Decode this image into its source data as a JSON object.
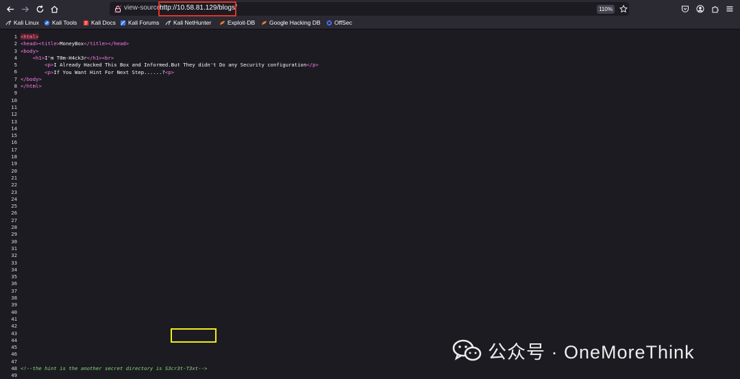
{
  "browser": {
    "url_prefix": "view-source:",
    "url": "http://10.58.81.129/blogs/",
    "zoom": "110%"
  },
  "bookmarks": [
    {
      "label": "Kali Linux",
      "icon": "kali-dragon-icon"
    },
    {
      "label": "Kali Tools",
      "icon": "kali-tools-icon"
    },
    {
      "label": "Kali Docs",
      "icon": "kali-docs-icon"
    },
    {
      "label": "Kali Forums",
      "icon": "kali-forums-icon"
    },
    {
      "label": "Kali NetHunter",
      "icon": "kali-nethunter-icon"
    },
    {
      "label": "Exploit-DB",
      "icon": "exploit-db-icon"
    },
    {
      "label": "Google Hacking DB",
      "icon": "ghdb-icon"
    },
    {
      "label": "OffSec",
      "icon": "offsec-icon"
    }
  ],
  "source": {
    "lines": {
      "l1": "<html>",
      "l2a": "<head><title>",
      "l2b": "MoneyBox",
      "l2c": "</title></head>",
      "l3": "<body>",
      "l4a": "    <h1>",
      "l4b": "I'm T0m-H4ck3r",
      "l4c": "</h1><br>",
      "l5a": "        <p>",
      "l5b": "I Already Hacked This Box and Informed.But They didn't Do any Security configuration",
      "l5c": "</p>",
      "l6a": "        <p>",
      "l6b": "If You Want Hint For Next Step......?",
      "l6c": "<p>",
      "l7": "</body>",
      "l8": "</html>",
      "l48": "<!--the hint is the another secret directory is S3cr3t-T3xt-->"
    },
    "line_count": 49
  },
  "watermark": {
    "text": "公众号 · OneMoreThink"
  },
  "colors": {
    "toolbar_bg": "#2b2a33",
    "page_bg": "#1c1b22",
    "tag": "#ff7de9",
    "comment": "#86de74",
    "url_highlight": "#e0342a",
    "secret_highlight": "#f2ee1a"
  }
}
